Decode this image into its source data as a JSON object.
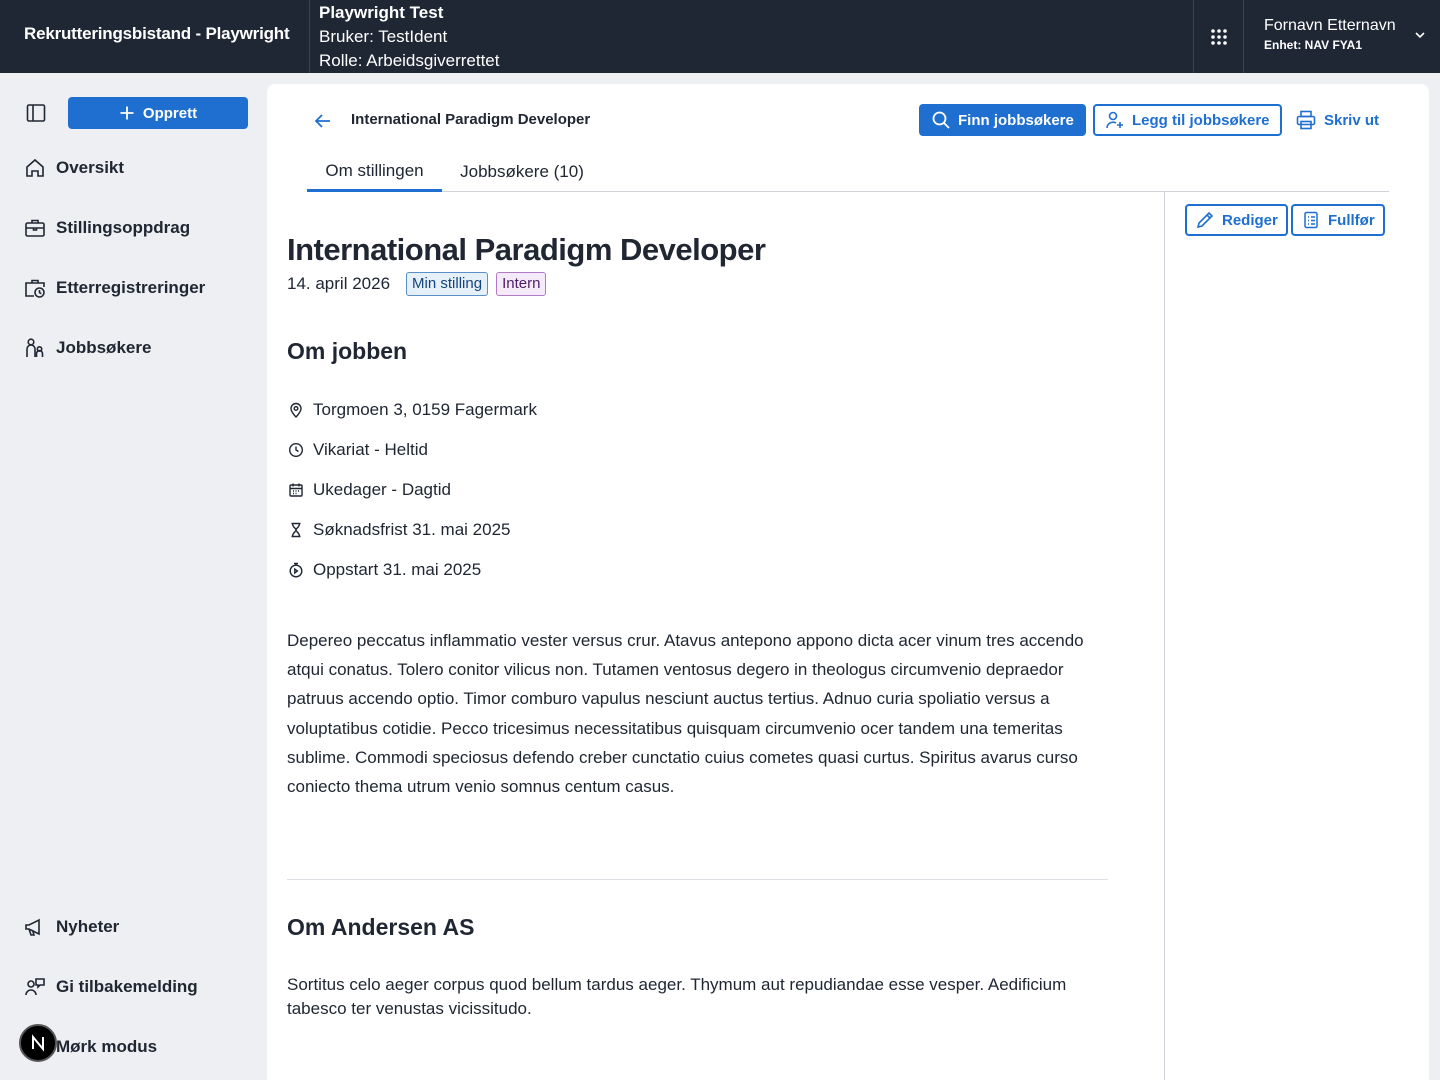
{
  "header": {
    "app_title": "Rekrutteringsbistand - Playwright",
    "env_title": "Playwright Test",
    "env_user": "Bruker: TestIdent",
    "env_role": "Rolle: Arbeidsgiverrettet",
    "user_name": "Fornavn Etternavn",
    "user_unit": "Enhet: NAV FYA1"
  },
  "sidebar": {
    "create_label": "Opprett",
    "items": [
      {
        "label": "Oversikt",
        "icon": "house-icon"
      },
      {
        "label": "Stillingsoppdrag",
        "icon": "briefcase-icon"
      },
      {
        "label": "Etterregistreringer",
        "icon": "briefcase-clock-icon"
      },
      {
        "label": "Jobbsøkere",
        "icon": "people-icon"
      }
    ],
    "bottom_items": [
      {
        "label": "Nyheter",
        "icon": "megaphone-icon"
      },
      {
        "label": "Gi tilbakemelding",
        "icon": "person-chat-icon"
      },
      {
        "label": "Mørk modus",
        "icon": "moon-icon"
      }
    ]
  },
  "page": {
    "breadcrumb_title": "International Paradigm Developer",
    "actions": {
      "find": "Finn jobbsøkere",
      "add": "Legg til jobbsøkere",
      "print": "Skriv ut"
    },
    "tabs": [
      {
        "label": "Om stillingen",
        "active": true
      },
      {
        "label": "Jobbsøkere (10)",
        "active": false
      }
    ],
    "side_actions": {
      "edit": "Rediger",
      "complete": "Fullfør"
    },
    "title": "International Paradigm Developer",
    "date": "14. april 2026",
    "tags": [
      "Min stilling",
      "Intern"
    ],
    "about_job_heading": "Om jobben",
    "info": [
      {
        "text": "Torgmoen 3, 0159 Fagermark",
        "icon": "location-pin-icon"
      },
      {
        "text": "Vikariat - Heltid",
        "icon": "clock-icon"
      },
      {
        "text": "Ukedager - Dagtid",
        "icon": "calendar-icon"
      },
      {
        "text": "Søknadsfrist 31. mai 2025",
        "icon": "hourglass-icon"
      },
      {
        "text": "Oppstart 31. mai 2025",
        "icon": "timer-icon"
      }
    ],
    "description": "Depereo peccatus inflammatio vester versus crur. Atavus antepono appono dicta acer vinum tres accendo atqui conatus. Tolero conitor vilicus non. Tutamen ventosus degero in theologus circumvenio depraedor patruus accendo optio. Timor comburo vapulus nesciunt auctus tertius. Adnuo curia spoliatio versus a voluptatibus cotidie. Pecco tricesimus necessitatibus quisquam circumvenio ocer tandem una temeritas sublime. Commodi speciosus defendo creber cunctatio cuius cometes quasi curtus. Spiritus avarus curso coniecto thema utrum venio somnus centum casus.",
    "employer_heading": "Om Andersen AS",
    "employer_description": "Sortitus celo aeger corpus quod bellum tardus aeger. Thymum aut repudiandae esse vesper. Aedificium tabesco ter venustas vicissitudo."
  },
  "colors": {
    "header_bg": "#1f2634",
    "accent": "#1f6fd1",
    "page_bg": "#edeff2"
  }
}
